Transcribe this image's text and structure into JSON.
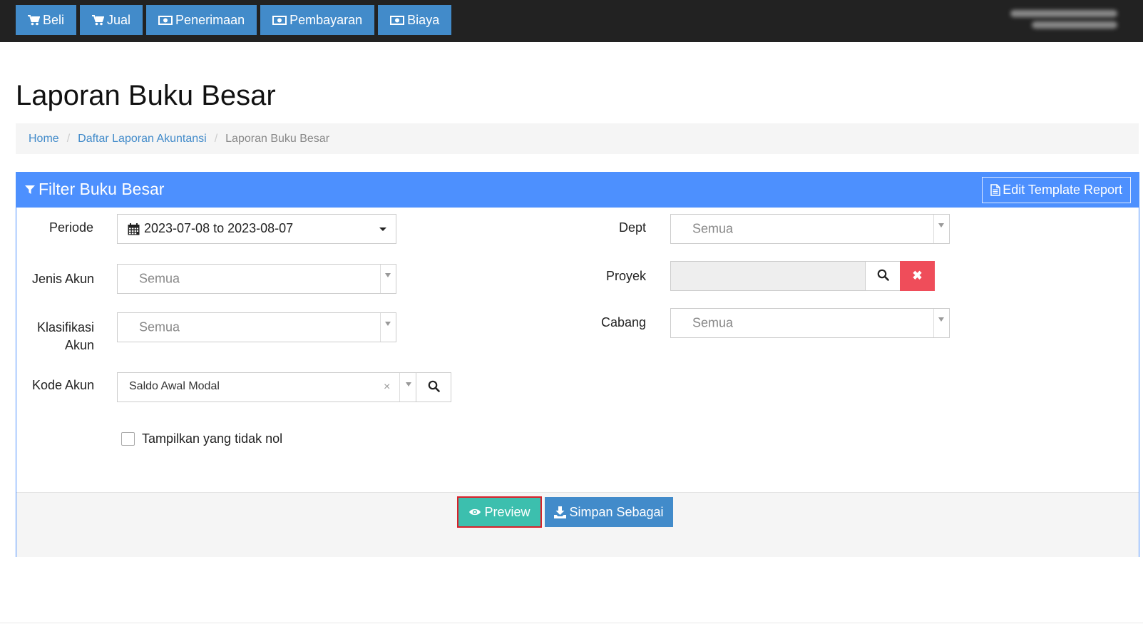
{
  "topnav": [
    {
      "label": "Beli",
      "icon": "cart-icon"
    },
    {
      "label": "Jual",
      "icon": "cart-icon"
    },
    {
      "label": "Penerimaan",
      "icon": "money-icon"
    },
    {
      "label": "Pembayaran",
      "icon": "money-icon"
    },
    {
      "label": "Biaya",
      "icon": "money-icon"
    }
  ],
  "page": {
    "title": "Laporan Buku Besar"
  },
  "breadcrumb": {
    "home": "Home",
    "parent": "Daftar Laporan Akuntansi",
    "current": "Laporan Buku Besar"
  },
  "panel": {
    "title": "Filter Buku Besar",
    "edit_template_label": "Edit Template Report"
  },
  "filters": {
    "periode_label": "Periode",
    "periode_value": "2023-07-08 to 2023-08-07",
    "jenis_akun_label": "Jenis Akun",
    "jenis_akun_value": "Semua",
    "klasifikasi_label_line1": "Klasifikasi",
    "klasifikasi_label_line2": "Akun",
    "klasifikasi_value": "Semua",
    "kode_akun_label": "Kode Akun",
    "kode_akun_value": "Saldo Awal Modal",
    "kode_akun_clear": "×",
    "dept_label": "Dept",
    "dept_value": "Semua",
    "proyek_label": "Proyek",
    "proyek_clear": "✖",
    "cabang_label": "Cabang",
    "cabang_value": "Semua",
    "nonzero_label": "Tampilkan yang tidak nol"
  },
  "actions": {
    "preview_label": "Preview",
    "save_as_label": "Simpan Sebagai"
  },
  "colors": {
    "topbar": "#222222",
    "nav_button": "#428bca",
    "panel_header": "#4d90fe",
    "preview": "#3cbfae",
    "preview_highlight": "#d9202a",
    "danger": "#ef4d5a"
  }
}
